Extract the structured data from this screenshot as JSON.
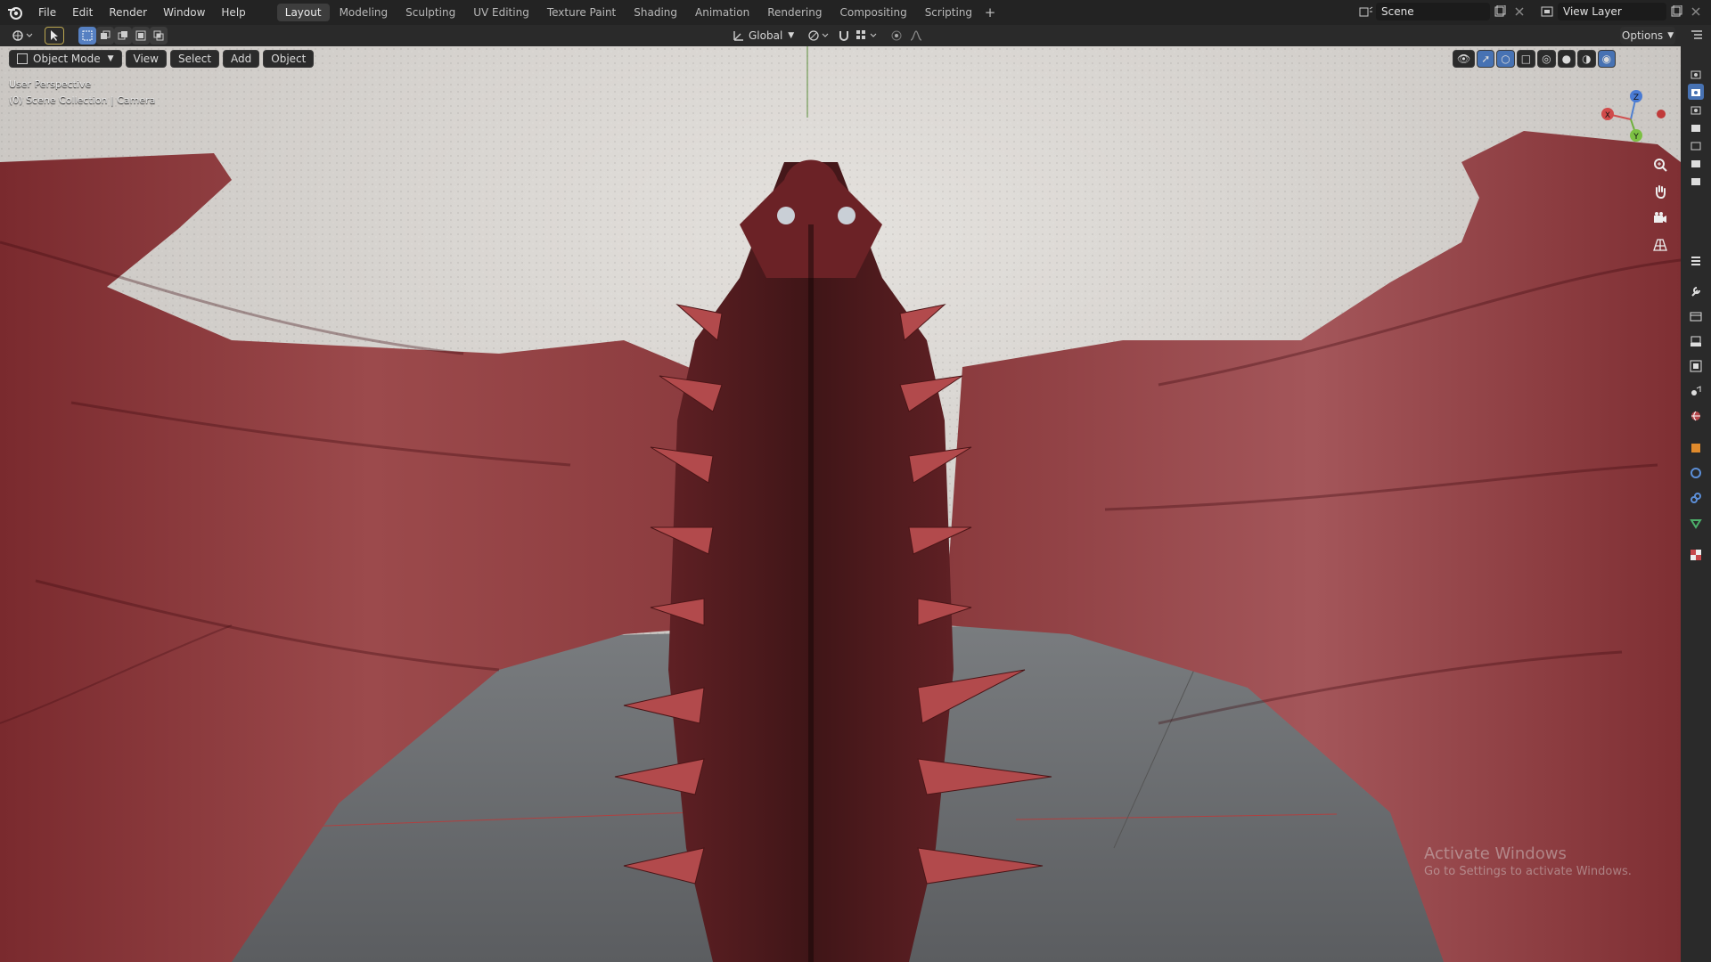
{
  "app": {
    "menus": [
      "File",
      "Edit",
      "Render",
      "Window",
      "Help"
    ]
  },
  "workspaces": {
    "tabs": [
      "Layout",
      "Modeling",
      "Sculpting",
      "UV Editing",
      "Texture Paint",
      "Shading",
      "Animation",
      "Rendering",
      "Compositing",
      "Scripting"
    ],
    "active": "Layout",
    "add_symbol": "+"
  },
  "scene": {
    "name": "Scene",
    "view_layer": "View Layer"
  },
  "toolbar": {
    "transform_orientation": "Global",
    "options_label": "Options"
  },
  "viewport": {
    "mode": "Object Mode",
    "menus": [
      "View",
      "Select",
      "Add",
      "Object"
    ],
    "perspective_label": "User Perspective",
    "collection_label": "(0) Scene Collection | Camera",
    "gizmo_axes": {
      "x": "X",
      "y": "Y",
      "z": "Z"
    }
  },
  "watermark": {
    "title": "Activate Windows",
    "subtitle": "Go to Settings to activate Windows."
  },
  "colors": {
    "accent": "#4772b3",
    "dragon": "#8e3a3c",
    "sky": "#d9d6d2",
    "ground": "#6e7073"
  }
}
